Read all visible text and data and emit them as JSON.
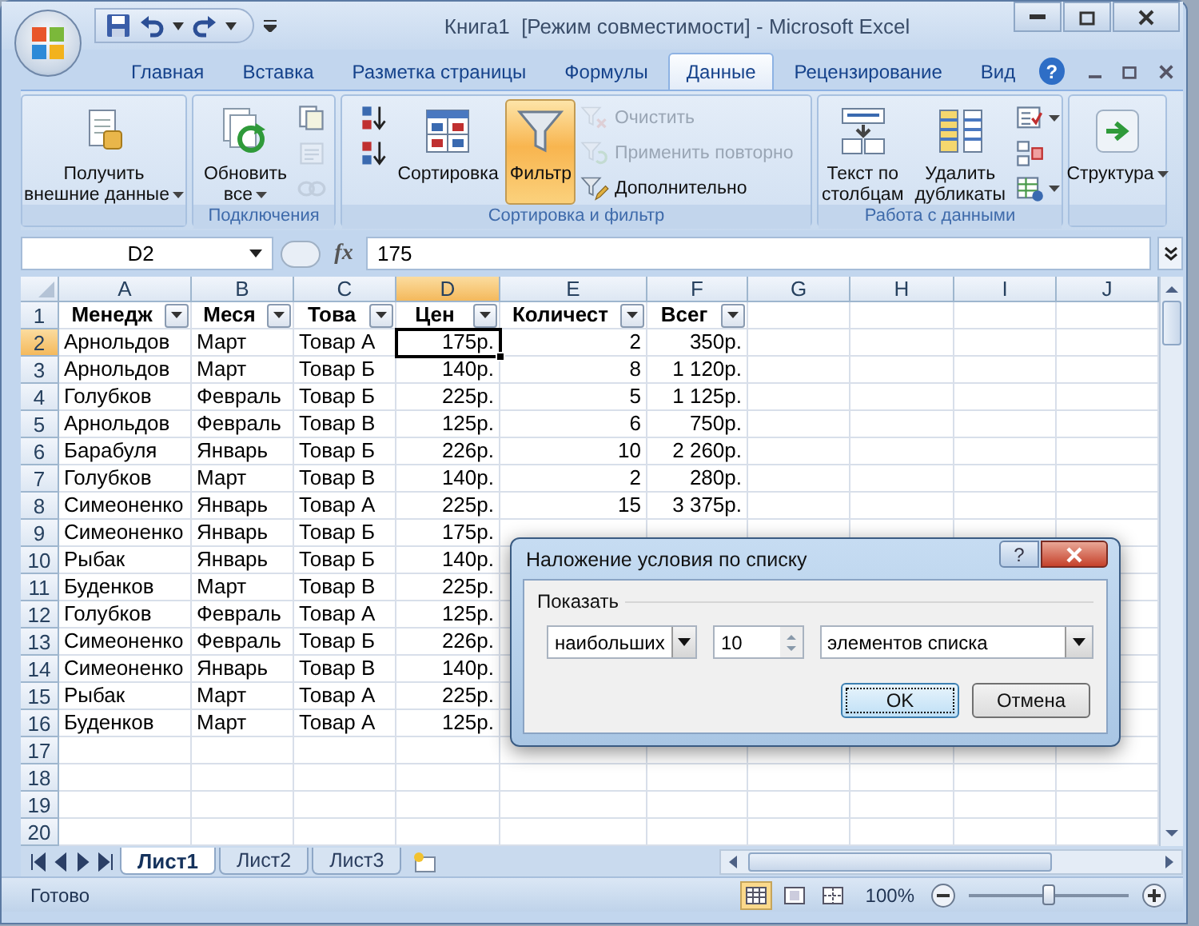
{
  "window": {
    "title": "Книга1  [Режим совместимости] - Microsoft Excel",
    "help": "?"
  },
  "tabs": [
    {
      "label": "Главная",
      "selected": false
    },
    {
      "label": "Вставка",
      "selected": false
    },
    {
      "label": "Разметка страницы",
      "selected": false
    },
    {
      "label": "Формулы",
      "selected": false
    },
    {
      "label": "Данные",
      "selected": true
    },
    {
      "label": "Рецензирование",
      "selected": false
    },
    {
      "label": "Вид",
      "selected": false
    }
  ],
  "ribbon": {
    "groups": [
      {
        "buttons": [
          {
            "kind": "large",
            "label": "Получить\nвнешние данные",
            "menu": true,
            "selected": false,
            "disabled": false
          }
        ]
      },
      {
        "label": "Подключения",
        "buttons": [
          {
            "kind": "large",
            "label": "Обновить\nвсе",
            "menu": true,
            "selected": false,
            "disabled": false
          },
          {
            "kind": "small",
            "menu": false,
            "selected": false,
            "disabled": false
          },
          {
            "kind": "small",
            "menu": false,
            "selected": false,
            "disabled": true
          },
          {
            "kind": "small",
            "menu": false,
            "selected": false,
            "disabled": true
          }
        ]
      },
      {
        "label": "Сортировка и фильтр",
        "buttons": [
          {
            "kind": "small",
            "menu": false,
            "selected": false,
            "disabled": false
          },
          {
            "kind": "small",
            "menu": false,
            "selected": false,
            "disabled": false
          },
          {
            "kind": "large",
            "label": "Сортировка",
            "menu": false,
            "selected": false,
            "disabled": false
          },
          {
            "kind": "large",
            "label": "Фильтр",
            "menu": false,
            "selected": true,
            "disabled": false
          },
          {
            "kind": "small",
            "label": "Очистить",
            "menu": false,
            "selected": false,
            "disabled": true
          },
          {
            "kind": "small",
            "label": "Применить повторно",
            "menu": false,
            "selected": false,
            "disabled": true
          },
          {
            "kind": "small",
            "label": "Дополнительно",
            "menu": false,
            "selected": false,
            "disabled": false
          }
        ]
      },
      {
        "label": "Работа с данными",
        "buttons": [
          {
            "kind": "large",
            "label": "Текст по\nстолбцам",
            "menu": false,
            "selected": false,
            "disabled": false
          },
          {
            "kind": "large",
            "label": "Удалить\nдубликаты",
            "menu": false,
            "selected": false,
            "disabled": false
          },
          {
            "kind": "small",
            "menu": true,
            "selected": false,
            "disabled": false
          },
          {
            "kind": "small",
            "menu": false,
            "selected": false,
            "disabled": false
          },
          {
            "kind": "small",
            "menu": true,
            "selected": false,
            "disabled": false
          }
        ]
      },
      {
        "buttons": [
          {
            "kind": "large",
            "label": "Структура",
            "menu": true,
            "selected": false,
            "disabled": false
          }
        ]
      }
    ]
  },
  "formula_bar": {
    "name_box": "D2",
    "function_button": "fx",
    "value": "175"
  },
  "sheet": {
    "columns": [
      {
        "label": "A",
        "selected": false
      },
      {
        "label": "B",
        "selected": false
      },
      {
        "label": "C",
        "selected": false
      },
      {
        "label": "D",
        "selected": true
      },
      {
        "label": "E",
        "selected": false
      },
      {
        "label": "F",
        "selected": false
      },
      {
        "label": "G",
        "selected": false
      },
      {
        "label": "H",
        "selected": false
      },
      {
        "label": "I",
        "selected": false
      },
      {
        "label": "J",
        "selected": false
      }
    ],
    "rows": [
      {
        "number": "1",
        "kind": "header",
        "selected": false,
        "cells": [
          "Менедж",
          "Меся",
          "Това",
          "Цен",
          "Количест",
          "Всег"
        ]
      },
      {
        "number": "2",
        "kind": "data",
        "selected": true,
        "cells": [
          "Арнольдов",
          "Март",
          "Товар А",
          "175р.",
          "2",
          "350р."
        ]
      },
      {
        "number": "3",
        "kind": "data",
        "selected": false,
        "cells": [
          "Арнольдов",
          "Март",
          "Товар Б",
          "140р.",
          "8",
          "1 120р."
        ]
      },
      {
        "number": "4",
        "kind": "data",
        "selected": false,
        "cells": [
          "Голубков",
          "Февраль",
          "Товар Б",
          "225р.",
          "5",
          "1 125р."
        ]
      },
      {
        "number": "5",
        "kind": "data",
        "selected": false,
        "cells": [
          "Арнольдов",
          "Февраль",
          "Товар В",
          "125р.",
          "6",
          "750р."
        ]
      },
      {
        "number": "6",
        "kind": "data",
        "selected": false,
        "cells": [
          "Барабуля",
          "Январь",
          "Товар Б",
          "226р.",
          "10",
          "2 260р."
        ]
      },
      {
        "number": "7",
        "kind": "data",
        "selected": false,
        "cells": [
          "Голубков",
          "Март",
          "Товар В",
          "140р.",
          "2",
          "280р."
        ]
      },
      {
        "number": "8",
        "kind": "data",
        "selected": false,
        "cells": [
          "Симеоненко",
          "Январь",
          "Товар А",
          "225р.",
          "15",
          "3 375р."
        ]
      },
      {
        "number": "9",
        "kind": "data",
        "selected": false,
        "cells": [
          "Симеоненко",
          "Январь",
          "Товар Б",
          "175р."
        ]
      },
      {
        "number": "10",
        "kind": "data",
        "selected": false,
        "cells": [
          "Рыбак",
          "Январь",
          "Товар Б",
          "140р."
        ]
      },
      {
        "number": "11",
        "kind": "data",
        "selected": false,
        "cells": [
          "Буденков",
          "Март",
          "Товар В",
          "225р."
        ]
      },
      {
        "number": "12",
        "kind": "data",
        "selected": false,
        "cells": [
          "Голубков",
          "Февраль",
          "Товар А",
          "125р."
        ]
      },
      {
        "number": "13",
        "kind": "data",
        "selected": false,
        "cells": [
          "Симеоненко",
          "Февраль",
          "Товар Б",
          "226р."
        ]
      },
      {
        "number": "14",
        "kind": "data",
        "selected": false,
        "cells": [
          "Симеоненко",
          "Январь",
          "Товар В",
          "140р."
        ]
      },
      {
        "number": "15",
        "kind": "data",
        "selected": false,
        "cells": [
          "Рыбак",
          "Март",
          "Товар А",
          "225р."
        ]
      },
      {
        "number": "16",
        "kind": "data",
        "selected": false,
        "cells": [
          "Буденков",
          "Март",
          "Товар А",
          "125р."
        ]
      },
      {
        "number": "17",
        "kind": "data",
        "selected": false
      },
      {
        "number": "18",
        "kind": "data",
        "selected": false
      },
      {
        "number": "19",
        "kind": "data",
        "selected": false
      },
      {
        "number": "20",
        "kind": "data",
        "selected": false
      }
    ]
  },
  "sheet_tabs": [
    {
      "label": "Лист1",
      "selected": true
    },
    {
      "label": "Лист2",
      "selected": false
    },
    {
      "label": "Лист3",
      "selected": false
    }
  ],
  "status_bar": {
    "status": "Готово",
    "views": [
      {
        "selected": true
      },
      {
        "selected": false
      },
      {
        "selected": false
      }
    ],
    "zoom": "100%",
    "level": 0.5
  },
  "dialog": {
    "title": "Наложение условия по списку",
    "help": "?",
    "group_label": "Показать",
    "direction": "наибольших",
    "count": "10",
    "unit": "элементов списка",
    "buttons": [
      {
        "label": "OK",
        "default": true
      },
      {
        "label": "Отмена",
        "default": false
      }
    ]
  }
}
